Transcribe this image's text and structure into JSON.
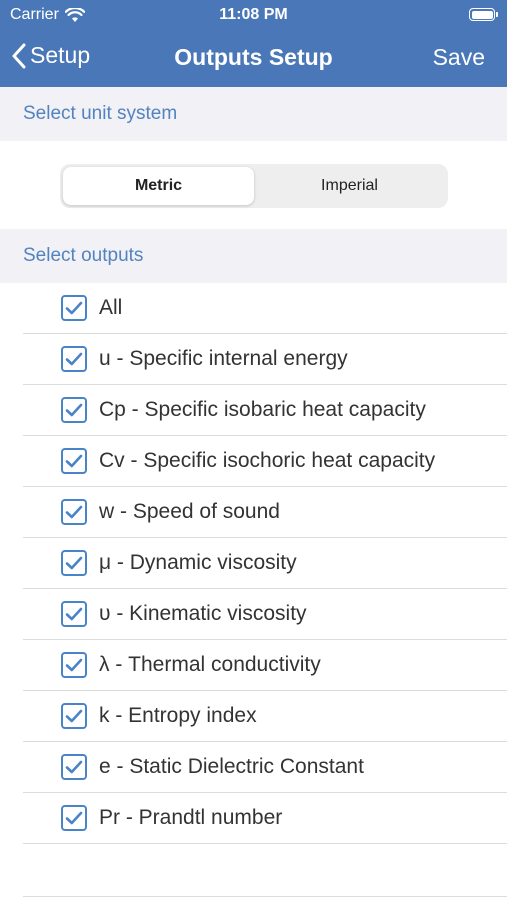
{
  "status_bar": {
    "carrier": "Carrier",
    "time": "11:08 PM",
    "battery_level": 1.0
  },
  "nav": {
    "back_label": "Setup",
    "title": "Outputs Setup",
    "save_label": "Save"
  },
  "unit_section": {
    "header": "Select unit system",
    "options": [
      "Metric",
      "Imperial"
    ],
    "selected": "Metric"
  },
  "outputs_section": {
    "header": "Select outputs",
    "items": [
      {
        "label": "All",
        "checked": true
      },
      {
        "label": "u - Specific internal energy",
        "checked": true
      },
      {
        "label": "Cp - Specific isobaric heat capacity",
        "checked": true
      },
      {
        "label": "Cv - Specific isochoric heat capacity",
        "checked": true
      },
      {
        "label": "w - Speed of sound",
        "checked": true
      },
      {
        "label": "μ - Dynamic viscosity",
        "checked": true
      },
      {
        "label": "υ - Kinematic viscosity",
        "checked": true
      },
      {
        "label": "λ - Thermal conductivity",
        "checked": true
      },
      {
        "label": "k - Entropy index",
        "checked": true
      },
      {
        "label": "e - Static Dielectric Constant",
        "checked": true
      },
      {
        "label": "Pr - Prandtl number",
        "checked": true
      }
    ]
  },
  "colors": {
    "nav_bar": "#4a77b8",
    "section_header_text": "#5283c0",
    "section_header_bg": "#f1f1f6",
    "checkbox": "#4a84c8"
  },
  "icons": {
    "wifi": "wifi-icon",
    "battery": "battery-icon",
    "back": "chevron-left-icon",
    "check": "checkmark-icon"
  }
}
